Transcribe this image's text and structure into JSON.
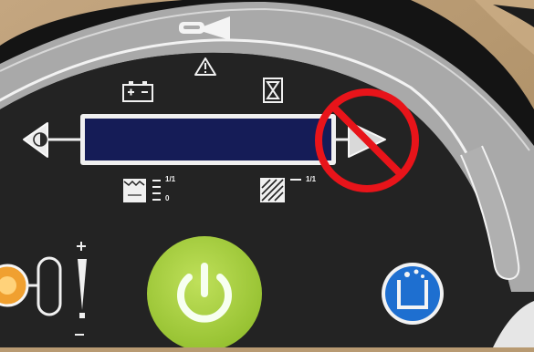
{
  "panel": {
    "battery_gauge_marks": {
      "top": "1/1",
      "bottom": "0"
    },
    "tank_gauge_mark": "1/1",
    "display_readout": ""
  },
  "colors": {
    "panel_dark": "#232323",
    "ring_grey": "#a9a9a9",
    "lcd_blue": "#151c57",
    "power_green": "#a7cf3e",
    "detergent_blue": "#1e6fd0",
    "prohibition_red": "#e8141a",
    "orange_lamp": "#f0a030"
  },
  "icons": [
    "horn-icon",
    "warning-icon",
    "battery-icon",
    "hourglass-icon",
    "contrast-icon",
    "clean-water-tank-icon",
    "dirty-water-tank-icon",
    "power-icon",
    "detergent-icon",
    "no-entry-icon"
  ]
}
